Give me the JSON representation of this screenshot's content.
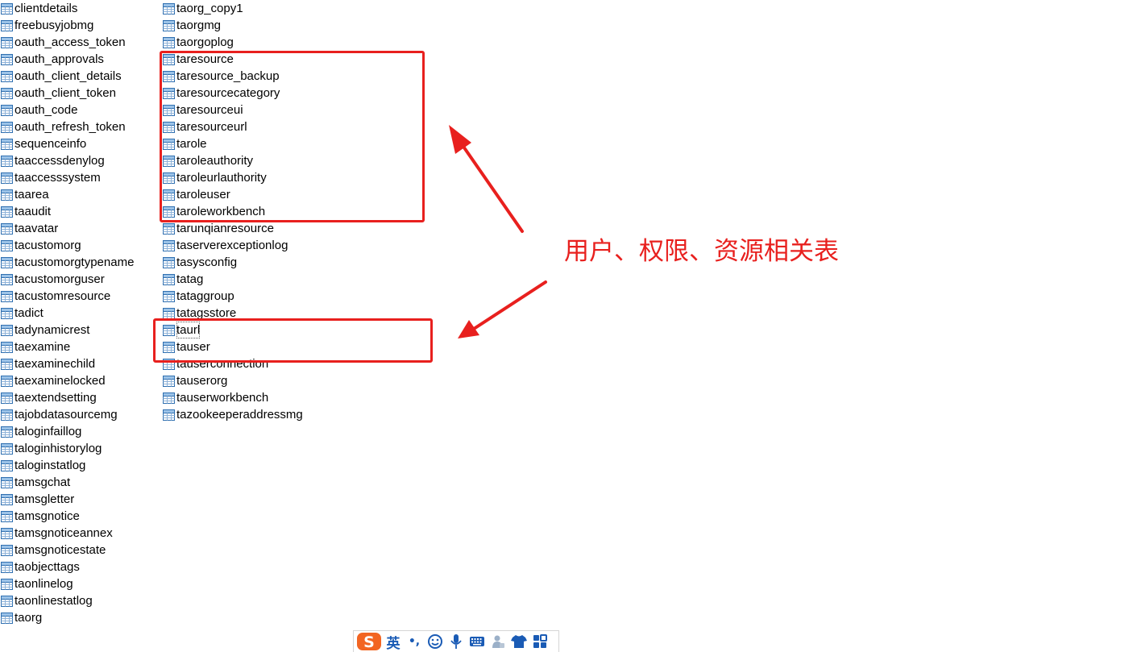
{
  "tables_left": [
    "clientdetails",
    "freebusyjobmg",
    "oauth_access_token",
    "oauth_approvals",
    "oauth_client_details",
    "oauth_client_token",
    "oauth_code",
    "oauth_refresh_token",
    "sequenceinfo",
    "taaccessdenylog",
    "taaccesssystem",
    "taarea",
    "taaudit",
    "taavatar",
    "tacustomorg",
    "tacustomorgtypename",
    "tacustomorguser",
    "tacustomresource",
    "tadict",
    "tadynamicrest",
    "taexamine",
    "taexaminechild",
    "taexaminelocked",
    "taextendsetting",
    "tajobdatasourcemg",
    "taloginfaillog",
    "taloginhistorylog",
    "taloginstatlog",
    "tamsgchat",
    "tamsgletter",
    "tamsgnotice",
    "tamsgnoticeannex",
    "tamsgnoticestate",
    "taobjecttags",
    "taonlinelog",
    "taonlinestatlog",
    "taorg"
  ],
  "tables_right": [
    "taorg_copy1",
    "taorgmg",
    "taorgoplog",
    "taresource",
    "taresource_backup",
    "taresourcecategory",
    "taresourceui",
    "taresourceurl",
    "tarole",
    "taroleauthority",
    "taroleurlauthority",
    "taroleuser",
    "taroleworkbench",
    "tarunqianresource",
    "taserverexceptionlog",
    "tasysconfig",
    "tatag",
    "tataggroup",
    "tatagsstore",
    "taurl",
    "tauser",
    "tauserconnection",
    "tauserorg",
    "tauserworkbench",
    "tazookeeperaddressmg"
  ],
  "focused_table": "taurl",
  "annotation": {
    "text": "用户、权限、资源相关表",
    "color": "#e8201e"
  },
  "ime_toolbar": {
    "logo_letter": "S",
    "mode_label": "英",
    "punct_label": "•,",
    "icons": [
      "emoji-icon",
      "microphone-icon",
      "keyboard-icon",
      "user-icon",
      "skin-icon",
      "toolbox-icon"
    ],
    "accent": "#1a5bb5",
    "logo_color": "#f26522"
  },
  "colors": {
    "icon_blue": "#2f6fb0",
    "highlight_red": "#e8201e"
  }
}
